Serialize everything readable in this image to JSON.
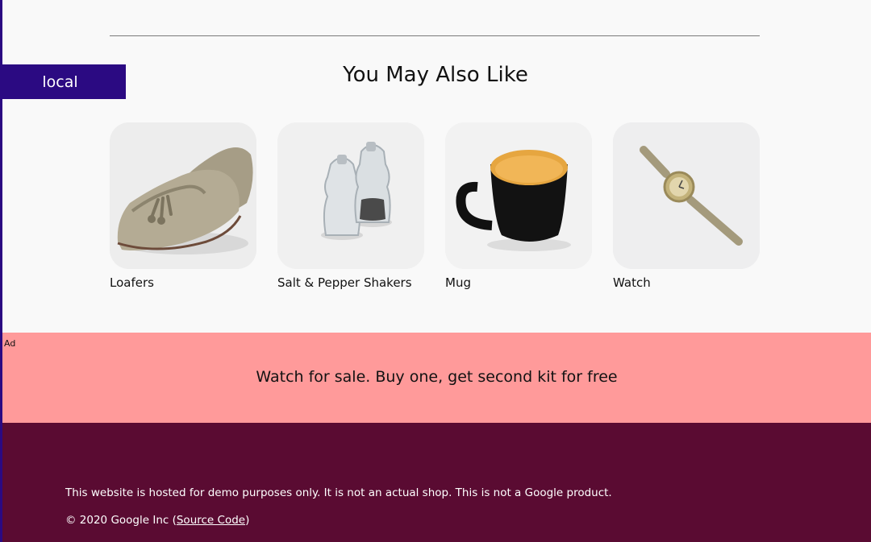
{
  "env_badge": "local",
  "section_title": "You May Also Like",
  "products": [
    {
      "name": "Loafers",
      "icon": "loafers-image"
    },
    {
      "name": "Salt & Pepper Shakers",
      "icon": "salt-pepper-shakers-image"
    },
    {
      "name": "Mug",
      "icon": "mug-image"
    },
    {
      "name": "Watch",
      "icon": "watch-image"
    }
  ],
  "ad": {
    "label": "Ad",
    "text": "Watch for sale. Buy one, get second kit for free"
  },
  "footer": {
    "disclaimer": "This website is hosted for demo purposes only. It is not an actual shop. This is not a Google product.",
    "copyright_prefix": "© 2020 Google Inc (",
    "source_link": "Source Code",
    "copyright_suffix": ")"
  },
  "colors": {
    "accent": "#2b0a82",
    "ad_background": "#ff9a9a",
    "footer_background": "#5a0b32",
    "page_background": "#f9f9f9"
  }
}
